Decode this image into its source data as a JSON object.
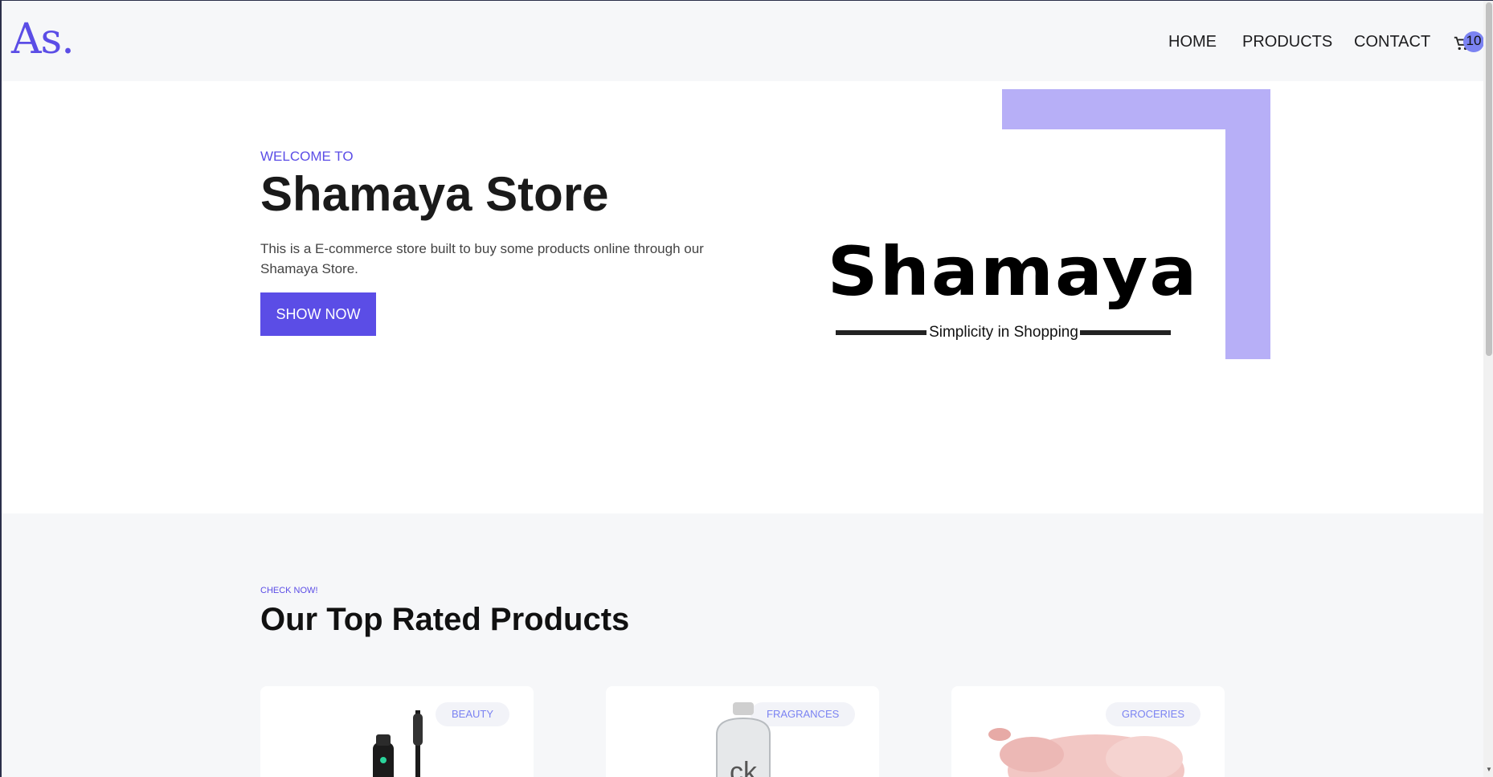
{
  "header": {
    "logo": "As.",
    "nav": {
      "home": "HOME",
      "products": "PRODUCTS",
      "contact": "CONTACT"
    },
    "cart_count": "10"
  },
  "hero": {
    "kicker": "WELCOME TO",
    "title": "Shamaya Store",
    "description": "This is a E-commerce store built to buy some products online through our Shamaya Store.",
    "button": "SHOW NOW",
    "brand_name": "Shamaya",
    "brand_tagline": "Simplicity in Shopping"
  },
  "section": {
    "kicker": "CHECK NOW!",
    "title": "Our Top Rated Products"
  },
  "products": [
    {
      "category": "BEAUTY",
      "image": "mascara-image"
    },
    {
      "category": "FRAGRANCES",
      "image": "ck-perfume-bottle-image"
    },
    {
      "category": "GROCERIES",
      "image": "raw-chicken-image"
    }
  ],
  "colors": {
    "accent": "#5b4de6",
    "accent_light": "#b7aff7",
    "badge": "#7b83f2",
    "section_bg": "#f6f7f9"
  },
  "icons": {
    "cart": "cart-icon"
  }
}
